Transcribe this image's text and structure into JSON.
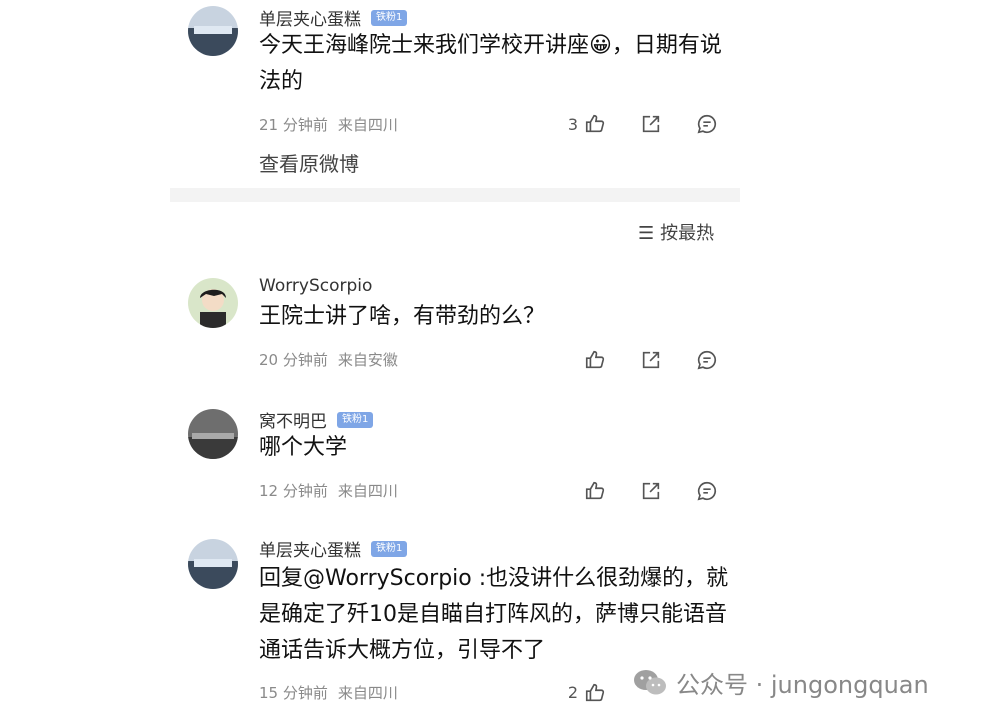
{
  "comments": [
    {
      "name": "单层夹心蛋糕",
      "badge": "铁粉1",
      "text": "今天王海峰院士来我们学校开讲座😀，日期有说法的",
      "time": "21 分钟前",
      "location": "来自四川",
      "likes": "3",
      "view_original": "查看原微博"
    },
    {
      "name": "WorryScorpio",
      "text": "王院士讲了啥，有带劲的么？",
      "time": "20 分钟前",
      "location": "来自安徽",
      "likes": ""
    },
    {
      "name": "窝不明巴",
      "badge": "铁粉1",
      "text": "哪个大学",
      "time": "12 分钟前",
      "location": "来自四川",
      "likes": ""
    },
    {
      "name": "单层夹心蛋糕",
      "badge": "铁粉1",
      "text": "回复@WorryScorpio :也没讲什么很劲爆的，就是确定了歼10是自瞄自打阵风的，萨博只能语音通话告诉大概方位，引导不了",
      "time": "15 分钟前",
      "location": "来自四川",
      "likes": "2"
    }
  ],
  "sort": {
    "label": "按最热",
    "icon": "sort-icon"
  },
  "watermark": {
    "text": "公众号 · jungongquan",
    "icon": "wechat-icon"
  },
  "colors": {
    "badge": "#7fa6e6",
    "meta": "#8a8a8a",
    "divider": "#f3f3f3"
  }
}
